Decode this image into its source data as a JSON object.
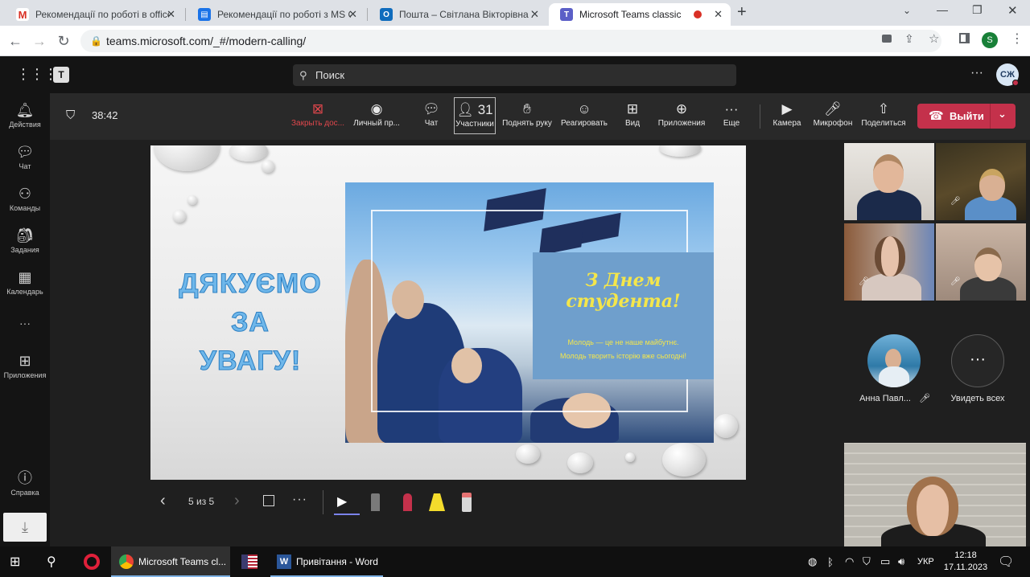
{
  "browser": {
    "tabs": [
      {
        "title": "Рекомендації по роботі в office",
        "icon": "gmail-icon",
        "color": "#d93025"
      },
      {
        "title": "Рекомендації по роботі з MS O",
        "icon": "outlook-doc-icon",
        "color": "#1a73e8"
      },
      {
        "title": "Пошта – Світлана Вікторівна Ж",
        "icon": "outlook-icon",
        "color": "#0f6cbd"
      },
      {
        "title": "Microsoft Teams classic",
        "icon": "teams-icon",
        "color": "#5b5fc7"
      }
    ],
    "new_tab": "+",
    "url": "teams.microsoft.com/_#/modern-calling/",
    "profile_initial": "S"
  },
  "teams": {
    "search_placeholder": "Поиск",
    "more": "···",
    "avatar_initials": "СЖ",
    "rail": [
      {
        "label": "Действия",
        "icon": "bell-icon"
      },
      {
        "label": "Чат",
        "icon": "chat-icon"
      },
      {
        "label": "Команды",
        "icon": "teams-group-icon"
      },
      {
        "label": "Задания",
        "icon": "assignments-icon"
      },
      {
        "label": "Календарь",
        "icon": "calendar-icon"
      },
      {
        "label": "Приложения",
        "icon": "apps-icon"
      },
      {
        "label": "Справка",
        "icon": "help-icon"
      }
    ],
    "rail_more": "···"
  },
  "call": {
    "timer": "38:42",
    "controls": [
      {
        "label": "Закрыть дос...",
        "icon": "close-share-icon",
        "color": "#e0474c"
      },
      {
        "label": "Личный пр...",
        "icon": "eye-icon"
      },
      {
        "label": "Чат",
        "icon": "chat-icon"
      },
      {
        "label": "Участники",
        "icon": "people-icon"
      },
      {
        "label": "Поднять руку",
        "icon": "hand-icon"
      },
      {
        "label": "Реагировать",
        "icon": "smile-icon"
      },
      {
        "label": "Вид",
        "icon": "layout-icon"
      },
      {
        "label": "Приложения",
        "icon": "plus-icon"
      },
      {
        "label": "Еще",
        "icon": "more-icon"
      },
      {
        "label": "Камера",
        "icon": "camera-icon"
      },
      {
        "label": "Микрофон",
        "icon": "mic-icon"
      },
      {
        "label": "Поделиться",
        "icon": "share-icon"
      }
    ],
    "participants_count": "31",
    "leave_label": "Выйти",
    "leave_color": "#c4314b"
  },
  "slide": {
    "thanks_lines": [
      "ДЯКУЄМО",
      "ЗА",
      "УВАГУ!"
    ],
    "card_title_1": "З Днем",
    "card_title_2": "студента!",
    "card_sub_1": "Молодь — це не наше майбутнє.",
    "card_sub_2": "Молодь творить історію вже сьогодні!",
    "counter": "5 из 5"
  },
  "gallery": {
    "named_participant": "Анна Павл...",
    "see_all": "Увидеть всех"
  },
  "taskbar": {
    "apps": [
      {
        "label": "Microsoft Teams cl...",
        "icon": "chrome-icon"
      },
      {
        "label": "Привітання - Word",
        "icon": "word-icon"
      }
    ],
    "lang": "УКР",
    "time": "12:18",
    "date": "17.11.2023"
  }
}
